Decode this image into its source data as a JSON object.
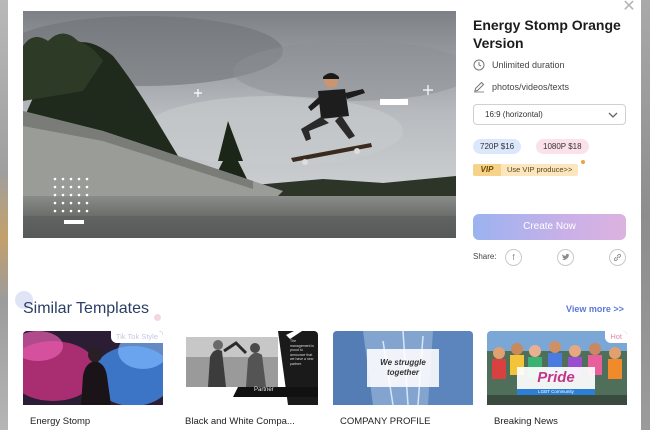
{
  "template": {
    "title": "Energy Stomp Orange Version",
    "duration": "Unlimited duration",
    "media": "photos/videos/texts",
    "aspect": "16:9 (horizontal)",
    "prices": [
      {
        "label": "720P  $16",
        "bg": "#dbe7fb"
      },
      {
        "label": "1080P  $18",
        "bg": "#fbe2ea"
      }
    ],
    "vip_badge": "VIP",
    "vip_link": "Use VIP produce>>",
    "create_label": "Create Now",
    "share_label": "Share:",
    "share_icons": [
      "facebook-icon",
      "twitter-icon",
      "link-icon"
    ]
  },
  "similar": {
    "title": "Similar Templates",
    "view_more": "View more >>",
    "cards": [
      {
        "label": "Energy Stomp",
        "tag": "Tik Tok Style"
      },
      {
        "label": "Black and White Compa...",
        "tag": "",
        "overlay_text": "Partner",
        "small_text": "The management is proud to announce that we have a new partner."
      },
      {
        "label": "COMPANY PROFILE",
        "tag": "",
        "overlay_text": "We struggle together"
      },
      {
        "label": "Breaking News",
        "tag": "Hot",
        "banner_text": "Pride",
        "sub_banner": "LGBT Community"
      }
    ]
  },
  "colors": {
    "accent_link": "#5b78d8",
    "title_dark": "#2c3e63",
    "vip_gold": "#f7d28a"
  }
}
